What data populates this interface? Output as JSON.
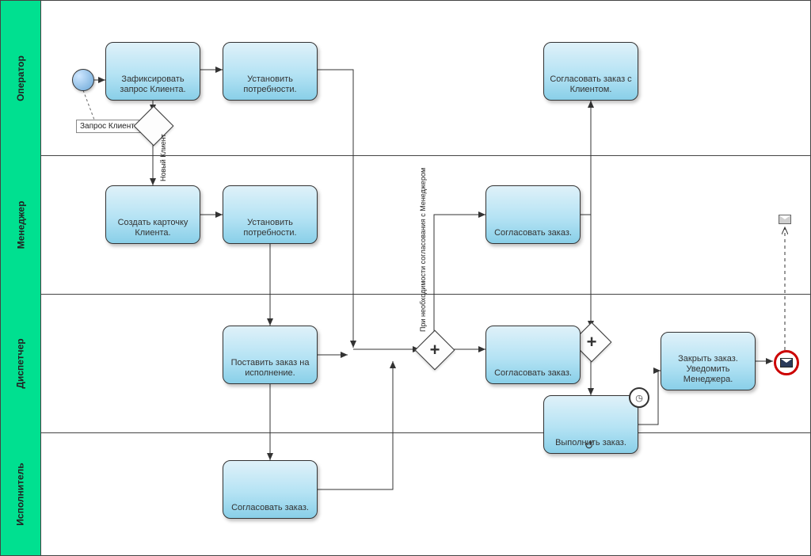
{
  "lanes": {
    "l0": "Оператор",
    "l1": "Менеджер",
    "l2": "Диспетчер",
    "l3": "Исполнитель"
  },
  "tasks": {
    "t1": "Зафиксировать запрос Клиента.",
    "t2": "Установить потребности.",
    "t3": "Согласовать заказ с Клиентом.",
    "t4": "Создать карточку Клиента.",
    "t5": "Установить потребности.",
    "t6": "Согласовать заказ.",
    "t7": "Поставить заказ на исполнение.",
    "t8": "Согласовать заказ.",
    "t9": "Выполнить заказ.",
    "t10": "Закрыть заказ. Уведомить Менеджера.",
    "t11": "Согласовать заказ."
  },
  "labels": {
    "start_annot": "Запрос Клиента",
    "new_client": "Новый Клиент",
    "need_manager": "При необходимости согласования с Менеджером"
  }
}
